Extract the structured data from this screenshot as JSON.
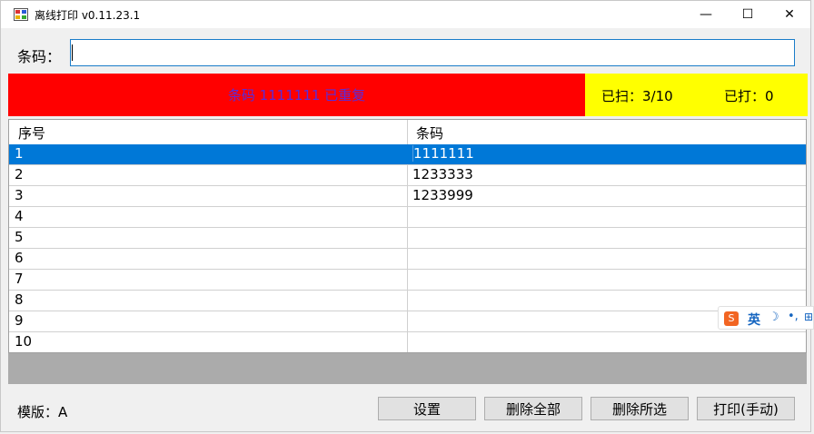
{
  "window": {
    "title": "离线打印 v0.11.23.1",
    "minimize_glyph": "—",
    "maximize_glyph": "☐",
    "close_glyph": "✕"
  },
  "barcode": {
    "label": "条码：",
    "value": ""
  },
  "status": {
    "message": "条码 1111111 已重复",
    "scanned": "已扫：3/10",
    "printed": "已打：0",
    "message_bg": "#ff0000",
    "counter_bg": "#ffff00"
  },
  "table": {
    "columns": [
      "序号",
      "条码"
    ],
    "rows": [
      {
        "index": "1",
        "barcode": "1111111"
      },
      {
        "index": "2",
        "barcode": "1233333"
      },
      {
        "index": "3",
        "barcode": "1233999"
      },
      {
        "index": "4",
        "barcode": ""
      },
      {
        "index": "5",
        "barcode": ""
      },
      {
        "index": "6",
        "barcode": ""
      },
      {
        "index": "7",
        "barcode": ""
      },
      {
        "index": "8",
        "barcode": ""
      },
      {
        "index": "9",
        "barcode": ""
      },
      {
        "index": "10",
        "barcode": ""
      }
    ],
    "selected_row": "1",
    "selection_color": "#0078d7"
  },
  "footer": {
    "template_label": "模版：A",
    "buttons": {
      "settings": "设置",
      "delete_all": "删除全部",
      "delete_selected": "删除所选",
      "print_manual": "打印(手动)"
    }
  },
  "ime": {
    "logo": "S",
    "language": "英",
    "mode_icon": "moon-icon",
    "punct": "•,",
    "keyboard": "⊞"
  }
}
